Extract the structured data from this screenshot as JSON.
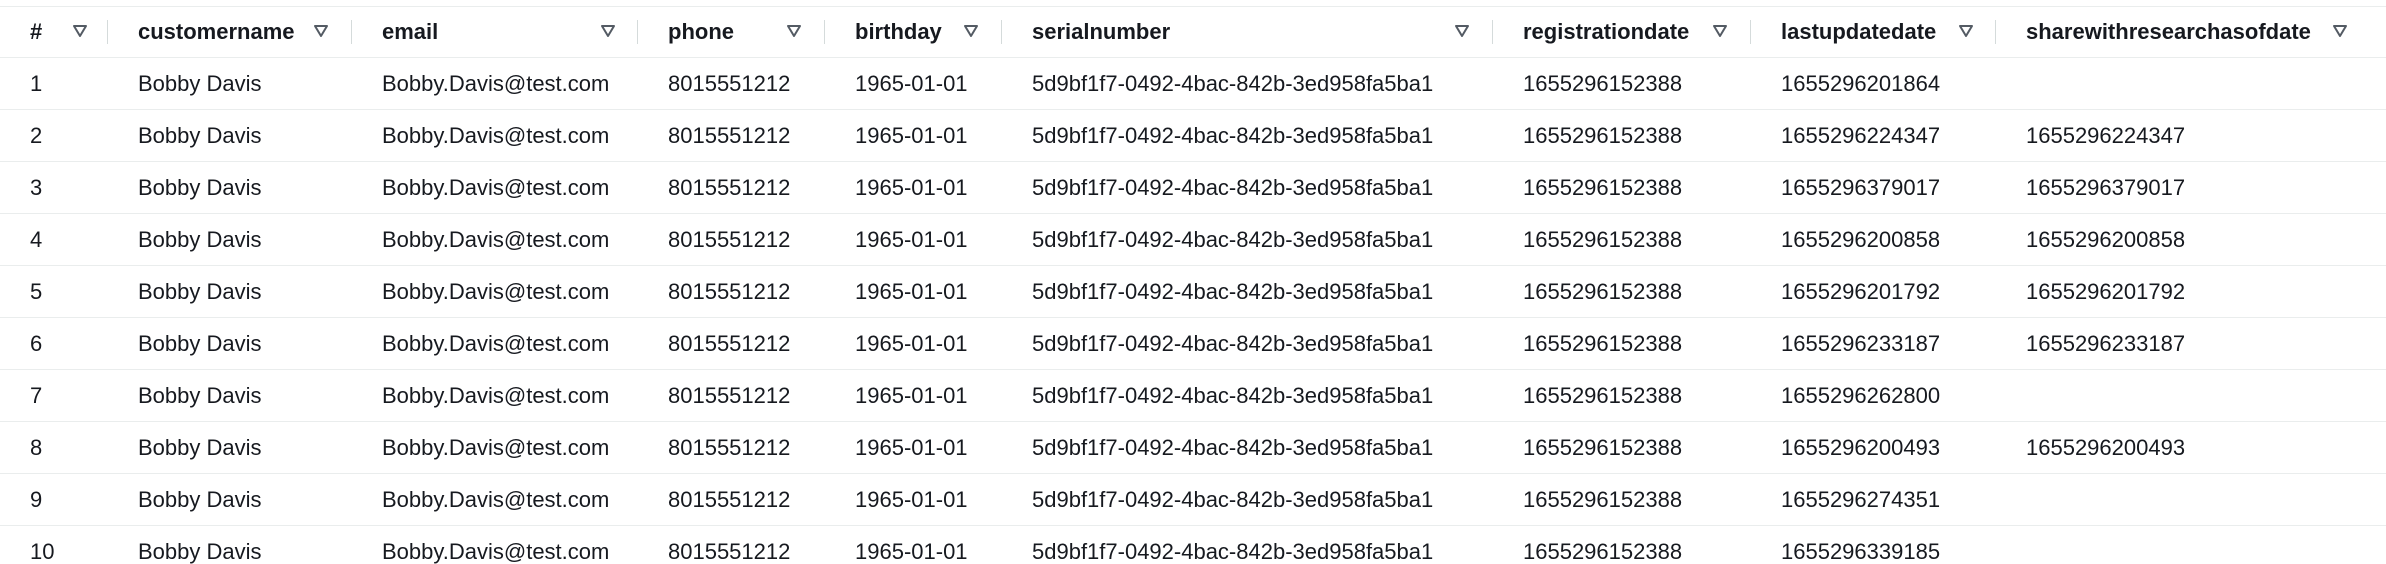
{
  "table": {
    "columns": [
      {
        "key": "num",
        "label": "#",
        "sort_icon": "filter-triangle-icon"
      },
      {
        "key": "customername",
        "label": "customername",
        "sort_icon": "filter-triangle-icon"
      },
      {
        "key": "email",
        "label": "email",
        "sort_icon": "filter-triangle-icon"
      },
      {
        "key": "phone",
        "label": "phone",
        "sort_icon": "filter-triangle-icon"
      },
      {
        "key": "birthday",
        "label": "birthday",
        "sort_icon": "filter-triangle-icon"
      },
      {
        "key": "serialnumber",
        "label": "serialnumber",
        "sort_icon": "filter-triangle-icon"
      },
      {
        "key": "registrationdate",
        "label": "registrationdate",
        "sort_icon": "filter-triangle-icon"
      },
      {
        "key": "lastupdatedate",
        "label": "lastupdatedate",
        "sort_icon": "filter-triangle-icon"
      },
      {
        "key": "sharewithresearchasofdate",
        "label": "sharewithresearchasofdate",
        "sort_icon": "filter-triangle-icon"
      }
    ],
    "rows": [
      [
        "1",
        "Bobby Davis",
        "Bobby.Davis@test.com",
        "8015551212",
        "1965-01-01",
        "5d9bf1f7-0492-4bac-842b-3ed958fa5ba1",
        "1655296152388",
        "1655296201864",
        ""
      ],
      [
        "2",
        "Bobby Davis",
        "Bobby.Davis@test.com",
        "8015551212",
        "1965-01-01",
        "5d9bf1f7-0492-4bac-842b-3ed958fa5ba1",
        "1655296152388",
        "1655296224347",
        "1655296224347"
      ],
      [
        "3",
        "Bobby Davis",
        "Bobby.Davis@test.com",
        "8015551212",
        "1965-01-01",
        "5d9bf1f7-0492-4bac-842b-3ed958fa5ba1",
        "1655296152388",
        "1655296379017",
        "1655296379017"
      ],
      [
        "4",
        "Bobby Davis",
        "Bobby.Davis@test.com",
        "8015551212",
        "1965-01-01",
        "5d9bf1f7-0492-4bac-842b-3ed958fa5ba1",
        "1655296152388",
        "1655296200858",
        "1655296200858"
      ],
      [
        "5",
        "Bobby Davis",
        "Bobby.Davis@test.com",
        "8015551212",
        "1965-01-01",
        "5d9bf1f7-0492-4bac-842b-3ed958fa5ba1",
        "1655296152388",
        "1655296201792",
        "1655296201792"
      ],
      [
        "6",
        "Bobby Davis",
        "Bobby.Davis@test.com",
        "8015551212",
        "1965-01-01",
        "5d9bf1f7-0492-4bac-842b-3ed958fa5ba1",
        "1655296152388",
        "1655296233187",
        "1655296233187"
      ],
      [
        "7",
        "Bobby Davis",
        "Bobby.Davis@test.com",
        "8015551212",
        "1965-01-01",
        "5d9bf1f7-0492-4bac-842b-3ed958fa5ba1",
        "1655296152388",
        "1655296262800",
        ""
      ],
      [
        "8",
        "Bobby Davis",
        "Bobby.Davis@test.com",
        "8015551212",
        "1965-01-01",
        "5d9bf1f7-0492-4bac-842b-3ed958fa5ba1",
        "1655296152388",
        "1655296200493",
        "1655296200493"
      ],
      [
        "9",
        "Bobby Davis",
        "Bobby.Davis@test.com",
        "8015551212",
        "1965-01-01",
        "5d9bf1f7-0492-4bac-842b-3ed958fa5ba1",
        "1655296152388",
        "1655296274351",
        ""
      ],
      [
        "10",
        "Bobby Davis",
        "Bobby.Davis@test.com",
        "8015551212",
        "1965-01-01",
        "5d9bf1f7-0492-4bac-842b-3ed958fa5ba1",
        "1655296152388",
        "1655296339185",
        ""
      ]
    ]
  },
  "colors": {
    "text": "#16191f",
    "border": "#eaeded",
    "separator": "#d5dbdb",
    "icon": "#545b64"
  }
}
